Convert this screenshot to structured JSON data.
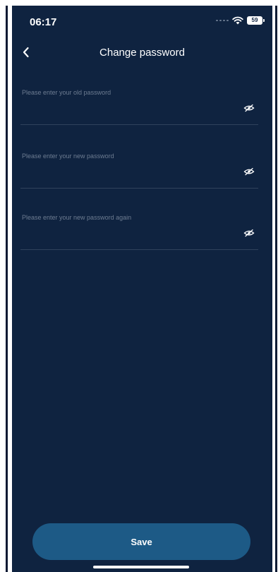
{
  "status_bar": {
    "time": "06:17",
    "battery": "59"
  },
  "header": {
    "title": "Change password",
    "back_icon": "chevron-left-icon"
  },
  "form": {
    "fields": [
      {
        "placeholder": "Please enter your old password",
        "value": "",
        "toggle_icon": "eye-off-icon"
      },
      {
        "placeholder": "Please enter your new password",
        "value": "",
        "toggle_icon": "eye-off-icon"
      },
      {
        "placeholder": "Please enter your new password again",
        "value": "",
        "toggle_icon": "eye-off-icon"
      }
    ],
    "save_label": "Save"
  },
  "colors": {
    "background": "#0f2340",
    "button": "#1d5a86",
    "divider": "#30425c",
    "placeholder": "#6d7c91",
    "text": "#ffffff"
  }
}
